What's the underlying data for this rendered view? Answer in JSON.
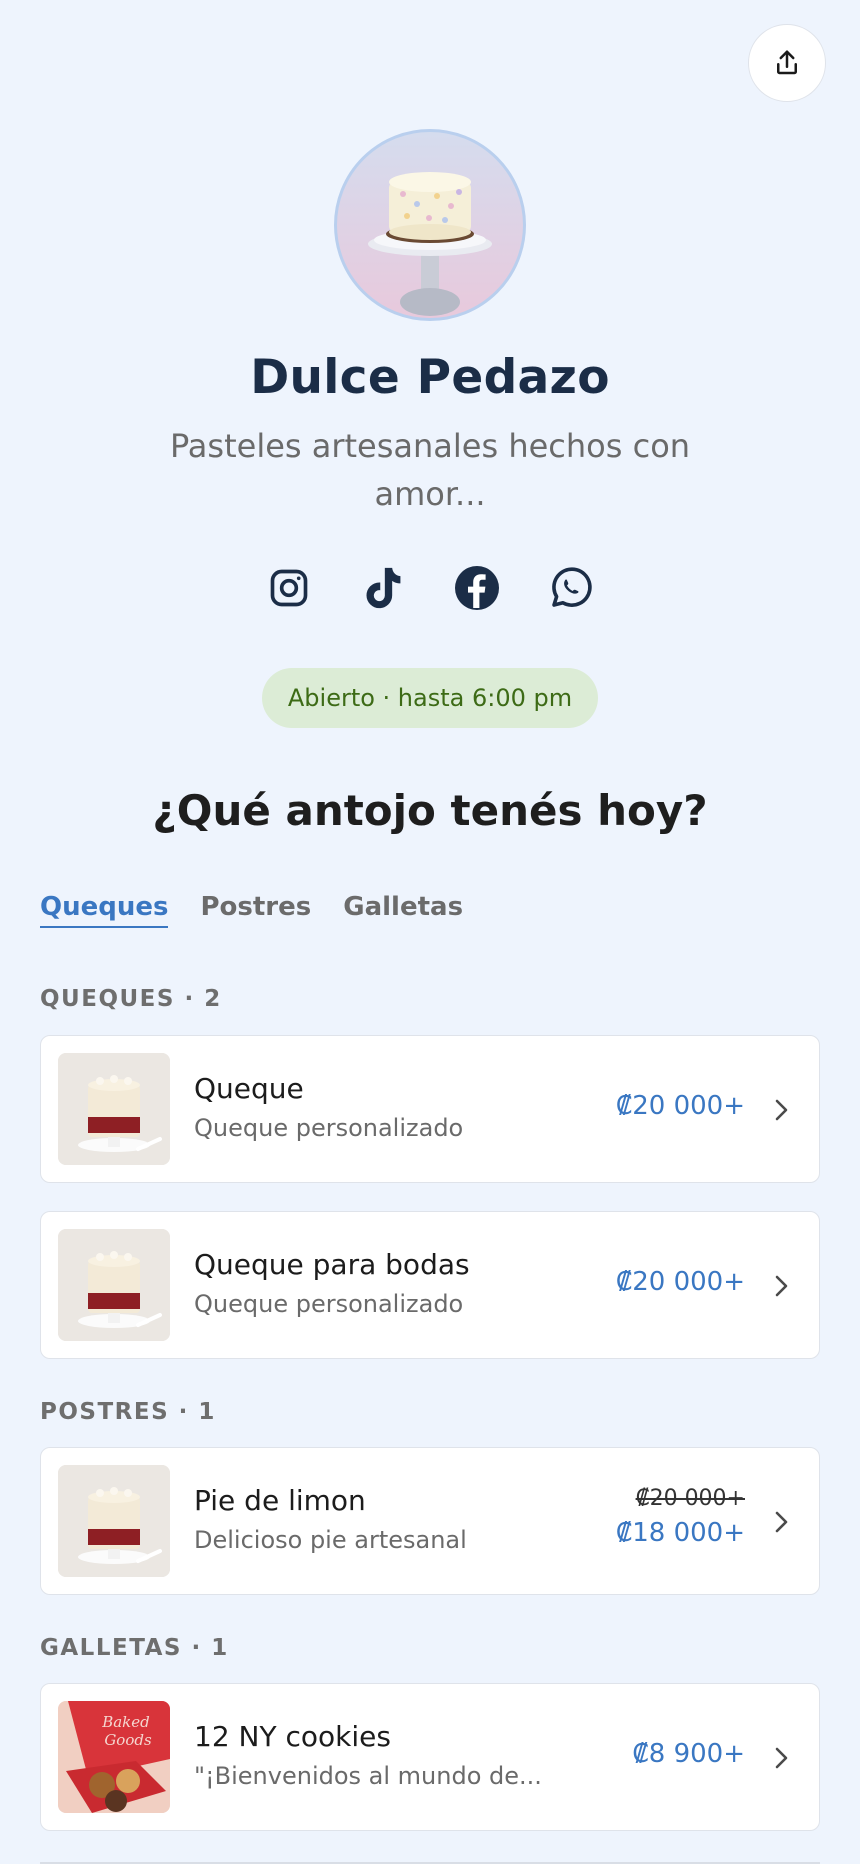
{
  "header": {
    "share_icon": "share-icon",
    "avatar_alt": "cake-photo"
  },
  "profile": {
    "name": "Dulce Pedazo",
    "tagline": "Pasteles artesanales hechos con amor..."
  },
  "socials": [
    {
      "icon": "instagram-icon"
    },
    {
      "icon": "tiktok-icon"
    },
    {
      "icon": "facebook-icon"
    },
    {
      "icon": "whatsapp-icon"
    }
  ],
  "status": {
    "text": "Abierto · hasta 6:00 pm",
    "color": "#3d6b16",
    "bg": "#dcecd6"
  },
  "menu": {
    "question": "¿Qué antojo tenés hoy?",
    "tabs": [
      {
        "label": "Queques",
        "active": true
      },
      {
        "label": "Postres",
        "active": false
      },
      {
        "label": "Galletas",
        "active": false
      }
    ]
  },
  "sections": [
    {
      "label": "QUEQUES · 2",
      "items": [
        {
          "title": "Queque",
          "subtitle": "Queque personalizado",
          "price": "₡20 000+"
        },
        {
          "title": "Queque para bodas",
          "subtitle": "Queque personalizado",
          "price": "₡20 000+"
        }
      ]
    },
    {
      "label": "POSTRES · 1",
      "items": [
        {
          "title": "Pie de limon",
          "subtitle": "Delicioso pie artesanal",
          "old_price": "₡20 000+",
          "price": "₡18 000+"
        }
      ]
    },
    {
      "label": "GALLETAS · 1",
      "items": [
        {
          "title": "12 NY cookies",
          "subtitle": "\"¡Bienvenidos al mundo de...",
          "price": "₡8 900+",
          "thumb_text": "Baked Goods"
        }
      ]
    }
  ],
  "colors": {
    "accent": "#3a77c2",
    "background": "#eef4fd",
    "title": "#1b2d47"
  }
}
